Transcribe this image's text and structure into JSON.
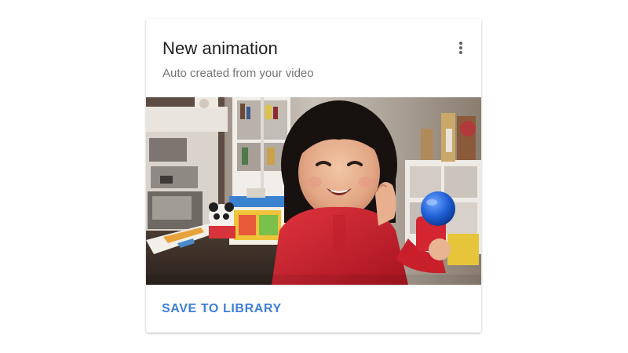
{
  "card": {
    "title": "New animation",
    "subtitle": "Auto created from your video",
    "menu_icon": "more-vert-icon",
    "media_alt": "Animated clip of a smiling child in a red jacket holding a blue ball in a playroom",
    "actions": {
      "save_label": "SAVE TO LIBRARY"
    }
  },
  "colors": {
    "accent": "#3d7fd8",
    "title_text": "#212121",
    "subtitle_text": "#757575",
    "card_background": "#ffffff"
  }
}
